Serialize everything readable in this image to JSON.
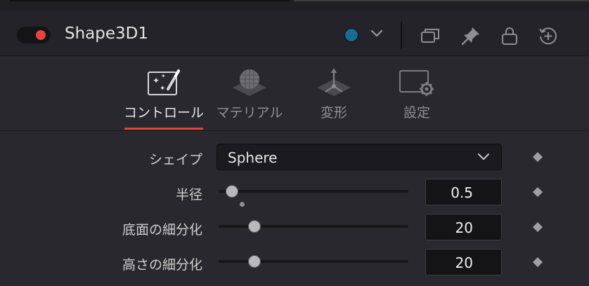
{
  "header": {
    "title": "Shape3D1",
    "toggle_color": "#e8433c",
    "node_color": "#1b6a93",
    "icons": [
      "window-icon",
      "pin-icon",
      "lock-icon",
      "reset-icon"
    ]
  },
  "tabs": [
    {
      "label": "コントロール",
      "icon": "magic-wand-icon",
      "active": true
    },
    {
      "label": "マテリアル",
      "icon": "material-sphere-icon",
      "active": false
    },
    {
      "label": "変形",
      "icon": "transform-icon",
      "active": false
    },
    {
      "label": "設定",
      "icon": "settings-icon",
      "active": false
    }
  ],
  "accent_color": "#e5443e",
  "controls": {
    "shape": {
      "label": "シェイプ",
      "value": "Sphere"
    },
    "radius": {
      "label": "半径",
      "value": "0.5"
    },
    "base_subdivisions": {
      "label": "底面の細分化",
      "value": "20"
    },
    "height_subdivisions": {
      "label": "高さの細分化",
      "value": "20"
    }
  }
}
